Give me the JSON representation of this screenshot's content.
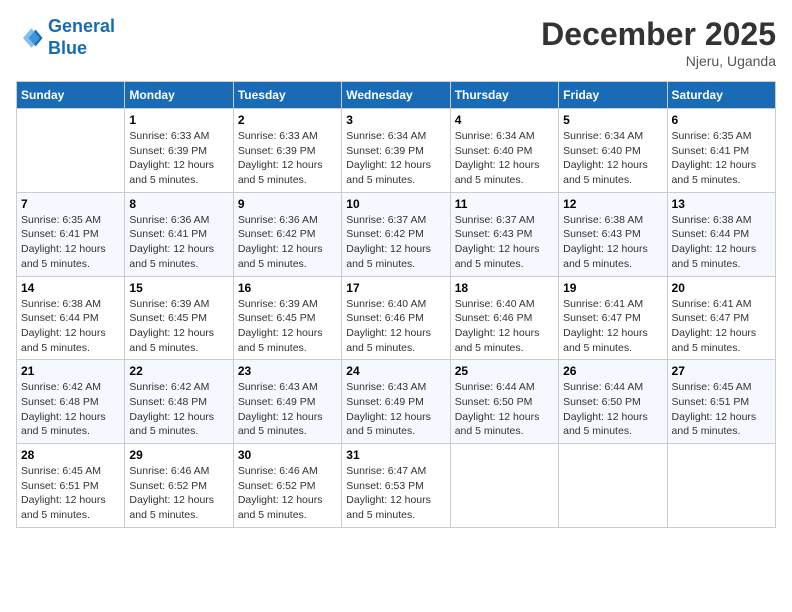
{
  "header": {
    "logo_line1": "General",
    "logo_line2": "Blue",
    "month_title": "December 2025",
    "location": "Njeru, Uganda"
  },
  "weekdays": [
    "Sunday",
    "Monday",
    "Tuesday",
    "Wednesday",
    "Thursday",
    "Friday",
    "Saturday"
  ],
  "weeks": [
    [
      {
        "day": "",
        "sunrise": "",
        "sunset": "",
        "daylight": ""
      },
      {
        "day": "1",
        "sunrise": "Sunrise: 6:33 AM",
        "sunset": "Sunset: 6:39 PM",
        "daylight": "Daylight: 12 hours and 5 minutes."
      },
      {
        "day": "2",
        "sunrise": "Sunrise: 6:33 AM",
        "sunset": "Sunset: 6:39 PM",
        "daylight": "Daylight: 12 hours and 5 minutes."
      },
      {
        "day": "3",
        "sunrise": "Sunrise: 6:34 AM",
        "sunset": "Sunset: 6:39 PM",
        "daylight": "Daylight: 12 hours and 5 minutes."
      },
      {
        "day": "4",
        "sunrise": "Sunrise: 6:34 AM",
        "sunset": "Sunset: 6:40 PM",
        "daylight": "Daylight: 12 hours and 5 minutes."
      },
      {
        "day": "5",
        "sunrise": "Sunrise: 6:34 AM",
        "sunset": "Sunset: 6:40 PM",
        "daylight": "Daylight: 12 hours and 5 minutes."
      },
      {
        "day": "6",
        "sunrise": "Sunrise: 6:35 AM",
        "sunset": "Sunset: 6:41 PM",
        "daylight": "Daylight: 12 hours and 5 minutes."
      }
    ],
    [
      {
        "day": "7",
        "sunrise": "Sunrise: 6:35 AM",
        "sunset": "Sunset: 6:41 PM",
        "daylight": "Daylight: 12 hours and 5 minutes."
      },
      {
        "day": "8",
        "sunrise": "Sunrise: 6:36 AM",
        "sunset": "Sunset: 6:41 PM",
        "daylight": "Daylight: 12 hours and 5 minutes."
      },
      {
        "day": "9",
        "sunrise": "Sunrise: 6:36 AM",
        "sunset": "Sunset: 6:42 PM",
        "daylight": "Daylight: 12 hours and 5 minutes."
      },
      {
        "day": "10",
        "sunrise": "Sunrise: 6:37 AM",
        "sunset": "Sunset: 6:42 PM",
        "daylight": "Daylight: 12 hours and 5 minutes."
      },
      {
        "day": "11",
        "sunrise": "Sunrise: 6:37 AM",
        "sunset": "Sunset: 6:43 PM",
        "daylight": "Daylight: 12 hours and 5 minutes."
      },
      {
        "day": "12",
        "sunrise": "Sunrise: 6:38 AM",
        "sunset": "Sunset: 6:43 PM",
        "daylight": "Daylight: 12 hours and 5 minutes."
      },
      {
        "day": "13",
        "sunrise": "Sunrise: 6:38 AM",
        "sunset": "Sunset: 6:44 PM",
        "daylight": "Daylight: 12 hours and 5 minutes."
      }
    ],
    [
      {
        "day": "14",
        "sunrise": "Sunrise: 6:38 AM",
        "sunset": "Sunset: 6:44 PM",
        "daylight": "Daylight: 12 hours and 5 minutes."
      },
      {
        "day": "15",
        "sunrise": "Sunrise: 6:39 AM",
        "sunset": "Sunset: 6:45 PM",
        "daylight": "Daylight: 12 hours and 5 minutes."
      },
      {
        "day": "16",
        "sunrise": "Sunrise: 6:39 AM",
        "sunset": "Sunset: 6:45 PM",
        "daylight": "Daylight: 12 hours and 5 minutes."
      },
      {
        "day": "17",
        "sunrise": "Sunrise: 6:40 AM",
        "sunset": "Sunset: 6:46 PM",
        "daylight": "Daylight: 12 hours and 5 minutes."
      },
      {
        "day": "18",
        "sunrise": "Sunrise: 6:40 AM",
        "sunset": "Sunset: 6:46 PM",
        "daylight": "Daylight: 12 hours and 5 minutes."
      },
      {
        "day": "19",
        "sunrise": "Sunrise: 6:41 AM",
        "sunset": "Sunset: 6:47 PM",
        "daylight": "Daylight: 12 hours and 5 minutes."
      },
      {
        "day": "20",
        "sunrise": "Sunrise: 6:41 AM",
        "sunset": "Sunset: 6:47 PM",
        "daylight": "Daylight: 12 hours and 5 minutes."
      }
    ],
    [
      {
        "day": "21",
        "sunrise": "Sunrise: 6:42 AM",
        "sunset": "Sunset: 6:48 PM",
        "daylight": "Daylight: 12 hours and 5 minutes."
      },
      {
        "day": "22",
        "sunrise": "Sunrise: 6:42 AM",
        "sunset": "Sunset: 6:48 PM",
        "daylight": "Daylight: 12 hours and 5 minutes."
      },
      {
        "day": "23",
        "sunrise": "Sunrise: 6:43 AM",
        "sunset": "Sunset: 6:49 PM",
        "daylight": "Daylight: 12 hours and 5 minutes."
      },
      {
        "day": "24",
        "sunrise": "Sunrise: 6:43 AM",
        "sunset": "Sunset: 6:49 PM",
        "daylight": "Daylight: 12 hours and 5 minutes."
      },
      {
        "day": "25",
        "sunrise": "Sunrise: 6:44 AM",
        "sunset": "Sunset: 6:50 PM",
        "daylight": "Daylight: 12 hours and 5 minutes."
      },
      {
        "day": "26",
        "sunrise": "Sunrise: 6:44 AM",
        "sunset": "Sunset: 6:50 PM",
        "daylight": "Daylight: 12 hours and 5 minutes."
      },
      {
        "day": "27",
        "sunrise": "Sunrise: 6:45 AM",
        "sunset": "Sunset: 6:51 PM",
        "daylight": "Daylight: 12 hours and 5 minutes."
      }
    ],
    [
      {
        "day": "28",
        "sunrise": "Sunrise: 6:45 AM",
        "sunset": "Sunset: 6:51 PM",
        "daylight": "Daylight: 12 hours and 5 minutes."
      },
      {
        "day": "29",
        "sunrise": "Sunrise: 6:46 AM",
        "sunset": "Sunset: 6:52 PM",
        "daylight": "Daylight: 12 hours and 5 minutes."
      },
      {
        "day": "30",
        "sunrise": "Sunrise: 6:46 AM",
        "sunset": "Sunset: 6:52 PM",
        "daylight": "Daylight: 12 hours and 5 minutes."
      },
      {
        "day": "31",
        "sunrise": "Sunrise: 6:47 AM",
        "sunset": "Sunset: 6:53 PM",
        "daylight": "Daylight: 12 hours and 5 minutes."
      },
      {
        "day": "",
        "sunrise": "",
        "sunset": "",
        "daylight": ""
      },
      {
        "day": "",
        "sunrise": "",
        "sunset": "",
        "daylight": ""
      },
      {
        "day": "",
        "sunrise": "",
        "sunset": "",
        "daylight": ""
      }
    ]
  ]
}
